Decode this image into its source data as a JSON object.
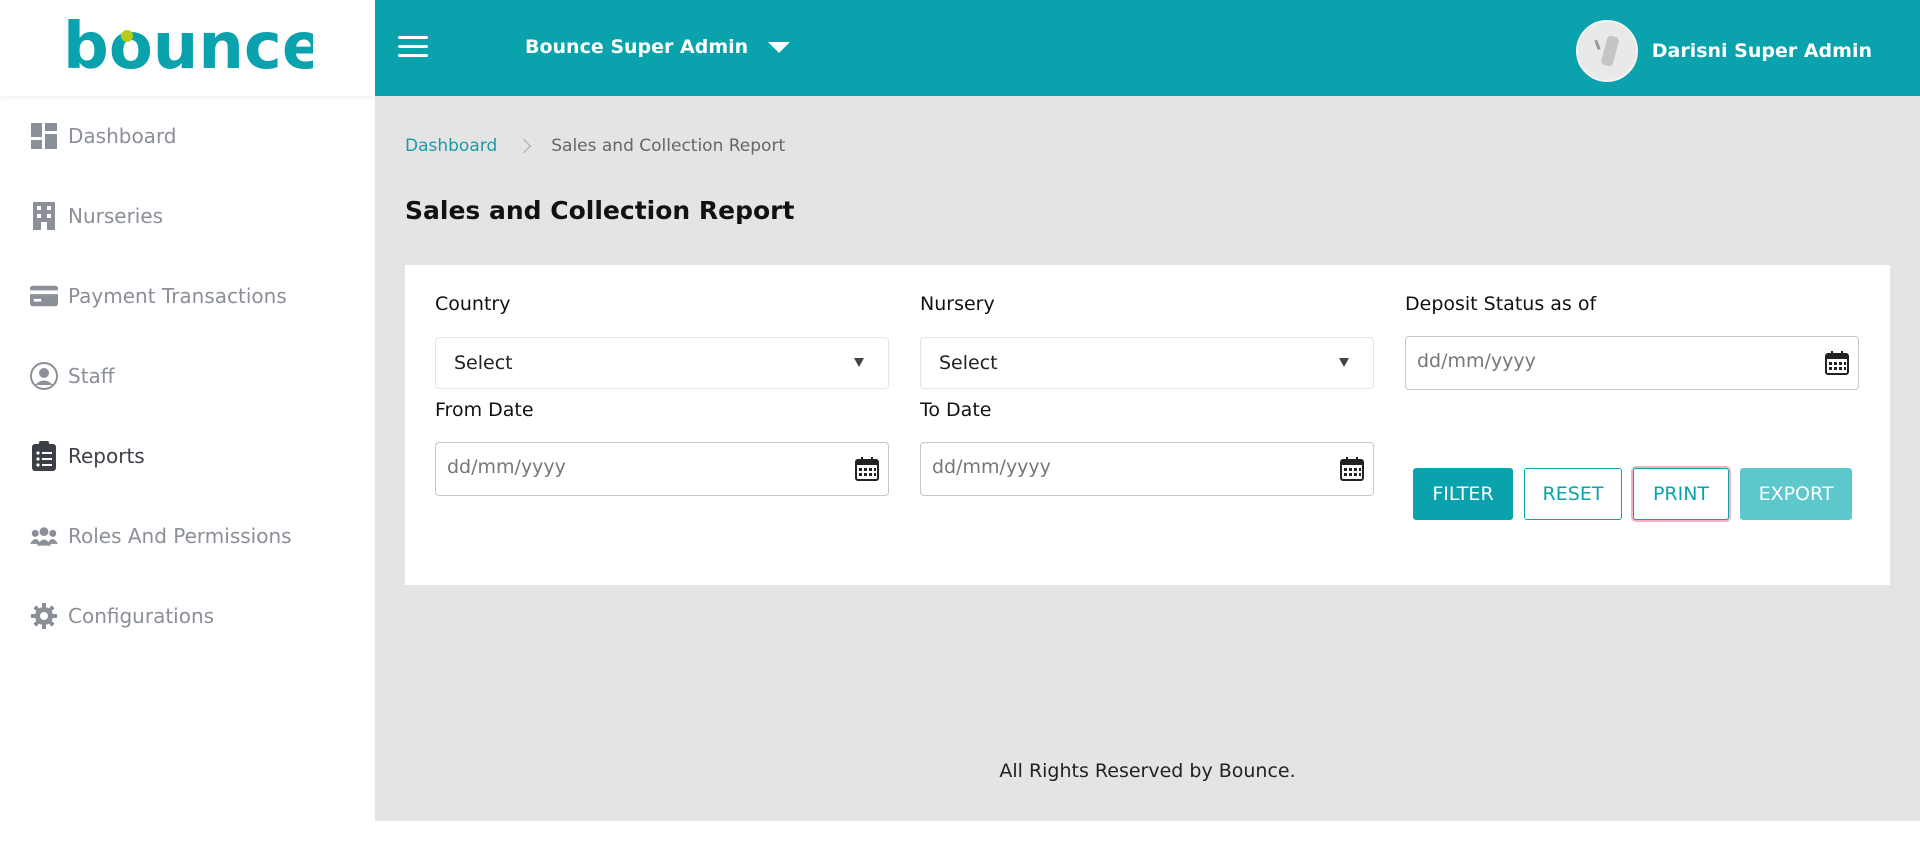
{
  "brand": {
    "logo_text": "bounce",
    "accent": "#0aa2ac",
    "logo_dot": "#b5cc1c"
  },
  "sidebar": {
    "items": [
      {
        "label": "Dashboard",
        "icon": "dashboard-icon"
      },
      {
        "label": "Nurseries",
        "icon": "building-icon"
      },
      {
        "label": "Payment Transactions",
        "icon": "credit-card-icon"
      },
      {
        "label": "Staff",
        "icon": "user-circle-icon"
      },
      {
        "label": "Reports",
        "icon": "clipboard-icon",
        "active": true
      },
      {
        "label": "Roles And Permissions",
        "icon": "users-icon"
      },
      {
        "label": "Configurations",
        "icon": "gear-icon"
      }
    ]
  },
  "header": {
    "org_name": "Bounce Super Admin",
    "user_name": "Darisni Super Admin"
  },
  "breadcrumb": {
    "home": "Dashboard",
    "current": "Sales and Collection Report"
  },
  "page": {
    "title": "Sales and Collection Report"
  },
  "filters": {
    "country": {
      "label": "Country",
      "value": "Select"
    },
    "nursery": {
      "label": "Nursery",
      "value": "Select"
    },
    "deposit_status": {
      "label": "Deposit Status as of",
      "placeholder": "dd/mm/yyyy"
    },
    "from_date": {
      "label": "From Date",
      "placeholder": "dd/mm/yyyy"
    },
    "to_date": {
      "label": "To Date",
      "placeholder": "dd/mm/yyyy"
    }
  },
  "actions": {
    "filter": "FILTER",
    "reset": "RESET",
    "print": "PRINT",
    "export": "EXPORT"
  },
  "footer": {
    "text": "All Rights Reserved by Bounce."
  }
}
